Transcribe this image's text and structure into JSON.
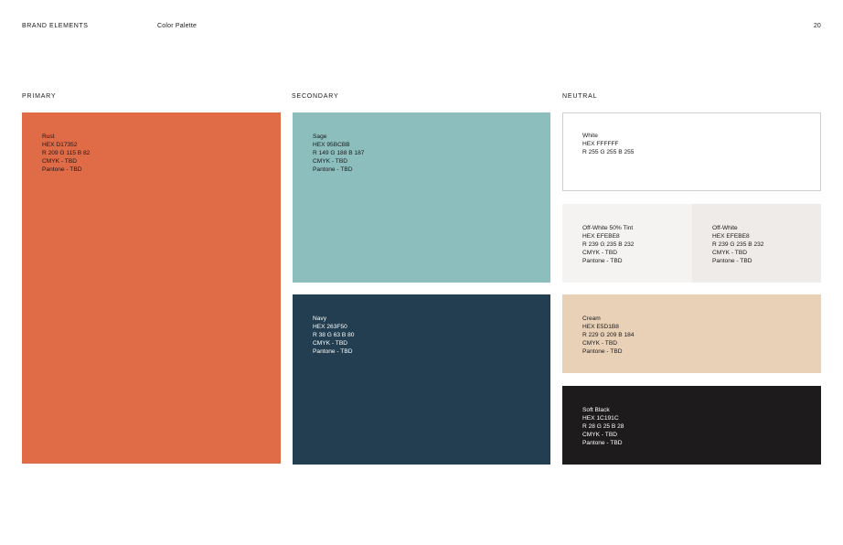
{
  "header": {
    "title": "BRAND ELEMENTS",
    "subtitle": "Color Palette",
    "page_number": "20"
  },
  "columns": {
    "primary": "PRIMARY",
    "secondary": "SECONDARY",
    "neutral": "NEUTRAL"
  },
  "swatches": {
    "rust": {
      "color": "#E06B47",
      "name": "Rust",
      "hex": "HEX D17352",
      "rgb": "R 209 G 115 B 82",
      "cmyk": "CMYK - TBD",
      "pantone": "Pantone - TBD"
    },
    "sage": {
      "color": "#8BBEBC",
      "name": "Sage",
      "hex": "HEX 95BCBB",
      "rgb": "R 149 G 188 B 187",
      "cmyk": "CMYK - TBD",
      "pantone": "Pantone - TBD"
    },
    "navy": {
      "color": "#223E50",
      "name": "Navy",
      "hex": "HEX 263F50",
      "rgb": "R 38 G 63 B 80",
      "cmyk": "CMYK - TBD",
      "pantone": "Pantone - TBD"
    },
    "white": {
      "color": "#FFFFFF",
      "name": "White",
      "hex": "HEX FFFFFF",
      "rgb": "R 255 G 255 B 255"
    },
    "offwhite50": {
      "color": "#F5F3F1",
      "name": "Off-White 50% Tint",
      "hex": "HEX EFEBE8",
      "rgb": "R 239 G 235 B 232",
      "cmyk": "CMYK - TBD",
      "pantone": "Pantone - TBD"
    },
    "offwhite": {
      "color": "#EFEBE8",
      "name": "Off-White",
      "hex": "HEX EFEBE8",
      "rgb": "R 239 G 235 B 232",
      "cmyk": "CMYK - TBD",
      "pantone": "Pantone - TBD"
    },
    "cream": {
      "color": "#E8D1B7",
      "name": "Cream",
      "hex": "HEX E5D1B8",
      "rgb": "R 229 G 209 B 184",
      "cmyk": "CMYK - TBD",
      "pantone": "Pantone - TBD"
    },
    "softblack": {
      "color": "#1E1B1D",
      "name": "Soft Black",
      "hex": "HEX 1C191C",
      "rgb": "R 28 G 25 B 28",
      "cmyk": "CMYK - TBD",
      "pantone": "Pantone - TBD"
    }
  }
}
